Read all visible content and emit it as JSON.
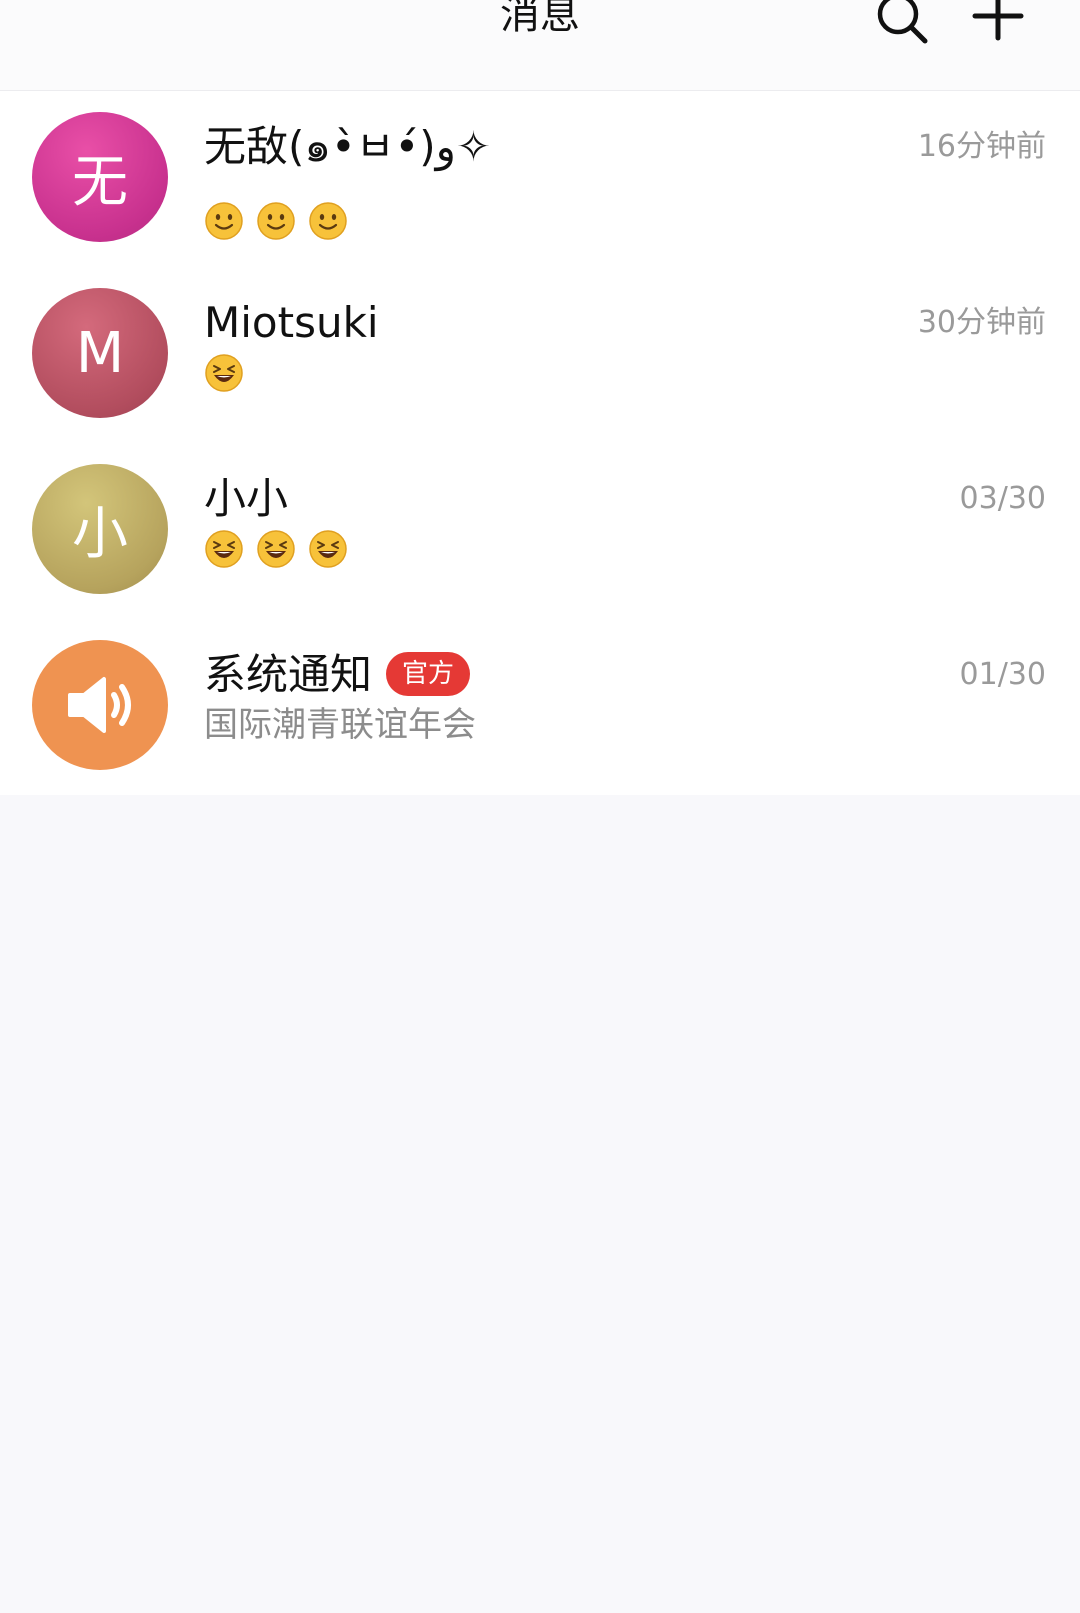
{
  "header": {
    "title": "消息",
    "search_icon": "search-icon",
    "add_icon": "plus-icon"
  },
  "conversations": [
    {
      "avatar_text": "无",
      "avatar_color": "#d83a98",
      "name": "无敌(๑•̀ㅂ•́)و✧",
      "time": "16分钟前",
      "preview_emojis": [
        "smile",
        "smile",
        "smile"
      ]
    },
    {
      "avatar_text": "M",
      "avatar_color": "#b85566",
      "name": "Miotsuki",
      "time": "30分钟前",
      "preview_emojis": [
        "grin"
      ]
    },
    {
      "avatar_text": "小",
      "avatar_color": "#bca964",
      "name": "小小",
      "time": "03/30",
      "preview_emojis": [
        "grin",
        "grin",
        "grin"
      ]
    },
    {
      "avatar_icon": "speaker-icon",
      "avatar_color": "#ef9351",
      "name": "系统通知",
      "badge": "官方",
      "badge_color": "#e53935",
      "time": "01/30",
      "preview_text": "国际潮青联谊年会"
    }
  ]
}
